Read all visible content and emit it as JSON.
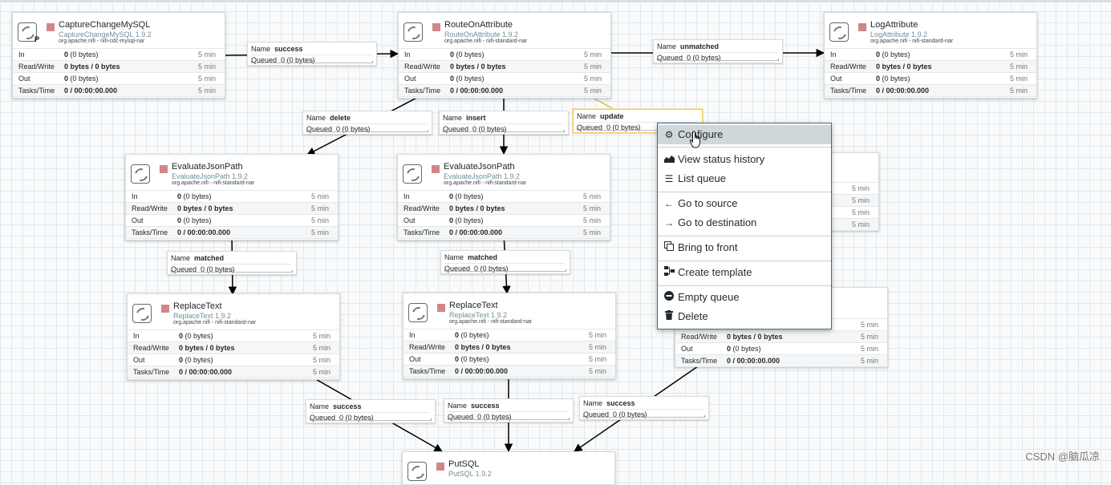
{
  "processors": [
    {
      "id": "p-capture",
      "name": "CaptureChangeMySQL",
      "type": "CaptureChangeMySQL 1.9.2",
      "bundle": "org.apache.nifi - nifi-cdc-mysql-nar",
      "primary": "P",
      "stats": [
        {
          "label": "In",
          "value": "0",
          "extra": "(0 bytes)",
          "time": "5 min"
        },
        {
          "label": "Read/Write",
          "value": "0 bytes / 0 bytes",
          "extra": "",
          "time": "5 min"
        },
        {
          "label": "Out",
          "value": "0",
          "extra": "(0 bytes)",
          "time": "5 min"
        },
        {
          "label": "Tasks/Time",
          "value": "0 / 00:00:00.000",
          "extra": "",
          "time": "5 min"
        }
      ]
    },
    {
      "id": "p-route",
      "name": "RouteOnAttribute",
      "type": "RouteOnAttribute 1.9.2",
      "bundle": "org.apache.nifi - nifi-standard-nar",
      "stats": [
        {
          "label": "In",
          "value": "0",
          "extra": "(0 bytes)",
          "time": "5 min"
        },
        {
          "label": "Read/Write",
          "value": "0 bytes / 0 bytes",
          "extra": "",
          "time": "5 min"
        },
        {
          "label": "Out",
          "value": "0",
          "extra": "(0 bytes)",
          "time": "5 min"
        },
        {
          "label": "Tasks/Time",
          "value": "0 / 00:00:00.000",
          "extra": "",
          "time": "5 min"
        }
      ]
    },
    {
      "id": "p-log",
      "name": "LogAttribute",
      "type": "LogAttribute 1.9.2",
      "bundle": "org.apache.nifi - nifi-standard-nar",
      "stats": [
        {
          "label": "In",
          "value": "0",
          "extra": "(0 bytes)",
          "time": "5 min"
        },
        {
          "label": "Read/Write",
          "value": "0 bytes / 0 bytes",
          "extra": "",
          "time": "5 min"
        },
        {
          "label": "Out",
          "value": "0",
          "extra": "(0 bytes)",
          "time": "5 min"
        },
        {
          "label": "Tasks/Time",
          "value": "0 / 00:00:00.000",
          "extra": "",
          "time": "5 min"
        }
      ]
    },
    {
      "id": "p-eval1",
      "name": "EvaluateJsonPath",
      "type": "EvaluateJsonPath 1.9.2",
      "bundle": "org.apache.nifi - nifi-standard-nar",
      "stats": [
        {
          "label": "In",
          "value": "0",
          "extra": "(0 bytes)",
          "time": "5 min"
        },
        {
          "label": "Read/Write",
          "value": "0 bytes / 0 bytes",
          "extra": "",
          "time": "5 min"
        },
        {
          "label": "Out",
          "value": "0",
          "extra": "(0 bytes)",
          "time": "5 min"
        },
        {
          "label": "Tasks/Time",
          "value": "0 / 00:00:00.000",
          "extra": "",
          "time": "5 min"
        }
      ]
    },
    {
      "id": "p-eval2",
      "name": "EvaluateJsonPath",
      "type": "EvaluateJsonPath 1.9.2",
      "bundle": "org.apache.nifi - nifi-standard-nar",
      "stats": [
        {
          "label": "In",
          "value": "0",
          "extra": "(0 bytes)",
          "time": "5 min"
        },
        {
          "label": "Read/Write",
          "value": "0 bytes / 0 bytes",
          "extra": "",
          "time": "5 min"
        },
        {
          "label": "Out",
          "value": "0",
          "extra": "(0 bytes)",
          "time": "5 min"
        },
        {
          "label": "Tasks/Time",
          "value": "0 / 00:00:00.000",
          "extra": "",
          "time": "5 min"
        }
      ]
    },
    {
      "id": "p-eval3",
      "name": "",
      "type": "",
      "bundle": "",
      "stats": [
        {
          "label": "",
          "value": "",
          "extra": "",
          "time": "5 min"
        },
        {
          "label": "",
          "value": "",
          "extra": "",
          "time": "5 min"
        },
        {
          "label": "",
          "value": "",
          "extra": "",
          "time": "5 min"
        },
        {
          "label": "",
          "value": "",
          "extra": "",
          "time": "5 min"
        }
      ]
    },
    {
      "id": "p-replace1",
      "name": "ReplaceText",
      "type": "ReplaceText 1.9.2",
      "bundle": "org.apache.nifi - nifi-standard-nar",
      "stats": [
        {
          "label": "In",
          "value": "0",
          "extra": "(0 bytes)",
          "time": "5 min"
        },
        {
          "label": "Read/Write",
          "value": "0 bytes / 0 bytes",
          "extra": "",
          "time": "5 min"
        },
        {
          "label": "Out",
          "value": "0",
          "extra": "(0 bytes)",
          "time": "5 min"
        },
        {
          "label": "Tasks/Time",
          "value": "0 / 00:00:00.000",
          "extra": "",
          "time": "5 min"
        }
      ]
    },
    {
      "id": "p-replace2",
      "name": "ReplaceText",
      "type": "ReplaceText 1.9.2",
      "bundle": "org.apache.nifi - nifi-standard-nar",
      "stats": [
        {
          "label": "In",
          "value": "0",
          "extra": "(0 bytes)",
          "time": "5 min"
        },
        {
          "label": "Read/Write",
          "value": "0 bytes / 0 bytes",
          "extra": "",
          "time": "5 min"
        },
        {
          "label": "Out",
          "value": "0",
          "extra": "(0 bytes)",
          "time": "5 min"
        },
        {
          "label": "Tasks/Time",
          "value": "0 / 00:00:00.000",
          "extra": "",
          "time": "5 min"
        }
      ]
    },
    {
      "id": "p-replace3",
      "name": "",
      "type": "",
      "bundle": "",
      "stats": [
        {
          "label": "",
          "value": "",
          "extra": "",
          "time": "5 min"
        },
        {
          "label": "Read/Write",
          "value": "0 bytes / 0 bytes",
          "extra": "",
          "time": "5 min"
        },
        {
          "label": "Out",
          "value": "0",
          "extra": "(0 bytes)",
          "time": "5 min"
        },
        {
          "label": "Tasks/Time",
          "value": "0 / 00:00:00.000",
          "extra": "",
          "time": "5 min"
        }
      ]
    },
    {
      "id": "p-putsql",
      "name": "PutSQL",
      "type": "PutSQL 1.9.2",
      "bundle": "",
      "stats": []
    }
  ],
  "connections": [
    {
      "id": "c-success-1",
      "name_label": "Name",
      "name": "success",
      "queued_label": "Queued",
      "queued": "0 (0 bytes)"
    },
    {
      "id": "c-unmatched",
      "name_label": "Name",
      "name": "unmatched",
      "queued_label": "Queued",
      "queued": "0 (0 bytes)"
    },
    {
      "id": "c-delete",
      "name_label": "Name",
      "name": "delete",
      "queued_label": "Queued",
      "queued": "0 (0 bytes)"
    },
    {
      "id": "c-insert",
      "name_label": "Name",
      "name": "insert",
      "queued_label": "Queued",
      "queued": "0 (0 bytes)"
    },
    {
      "id": "c-update",
      "name_label": "Name",
      "name": "update",
      "queued_label": "Queued",
      "queued": "0 (0 bytes)",
      "selected": true
    },
    {
      "id": "c-matched-1",
      "name_label": "Name",
      "name": "matched",
      "queued_label": "Queued",
      "queued": "0 (0 bytes)"
    },
    {
      "id": "c-matched-2",
      "name_label": "Name",
      "name": "matched",
      "queued_label": "Queued",
      "queued": "0 (0 bytes)"
    },
    {
      "id": "c-success-2",
      "name_label": "Name",
      "name": "success",
      "queued_label": "Queued",
      "queued": "0 (0 bytes)"
    },
    {
      "id": "c-success-3",
      "name_label": "Name",
      "name": "success",
      "queued_label": "Queued",
      "queued": "0 (0 bytes)"
    },
    {
      "id": "c-success-4",
      "name_label": "Name",
      "name": "success",
      "queued_label": "Queued",
      "queued": "0 (0 bytes)"
    }
  ],
  "context_menu": {
    "items": [
      {
        "label": "Configure",
        "icon": "gear-icon",
        "highlighted": true
      },
      {
        "label": "View status history",
        "icon": "area-chart-icon"
      },
      {
        "label": "List queue",
        "icon": "list-icon"
      },
      {
        "label": "Go to source",
        "icon": "arrow-left-icon"
      },
      {
        "label": "Go to destination",
        "icon": "arrow-right-icon"
      },
      {
        "label": "Bring to front",
        "icon": "clone-icon"
      },
      {
        "label": "Create template",
        "icon": "template-icon"
      },
      {
        "label": "Empty queue",
        "icon": "minus-circle-icon"
      },
      {
        "label": "Delete",
        "icon": "trash-icon"
      }
    ]
  },
  "watermark": "CSDN @脑瓜凉"
}
